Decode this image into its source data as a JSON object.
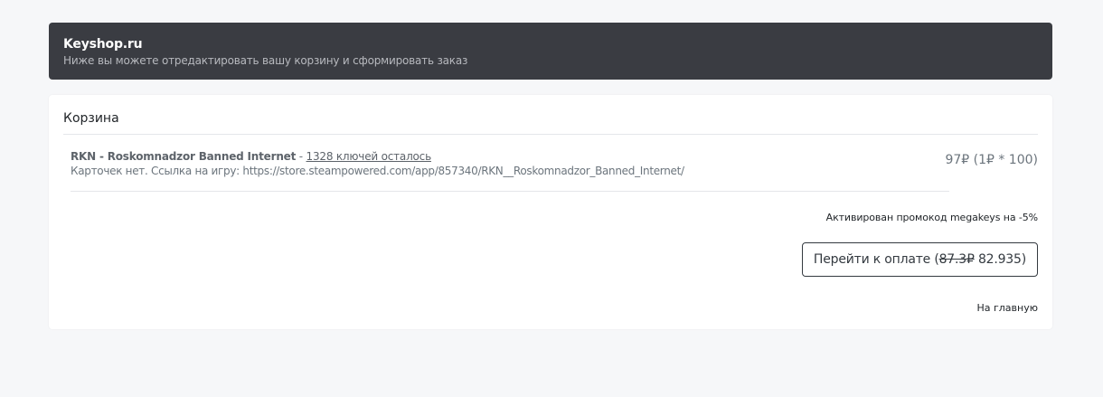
{
  "header": {
    "site_title": "Keyshop.ru",
    "subtitle": "Ниже вы можете отредактировать вашу корзину и сформировать заказ",
    "background_color": "#3a3c42"
  },
  "cart": {
    "title": "Корзина",
    "items": [
      {
        "name": "RKN - Roskomnadzor Banned Internet",
        "separator": " - ",
        "keys_left": "1328 ключей осталось",
        "description": "Карточек нет. Ссылка на игру: https://store.steampowered.com/app/857340/RKN__Roskomnadzor_Banned_Internet/",
        "price": "97₽ (1₽ * 100)"
      }
    ],
    "promo_text": "Активирован промокод megakeys на -5%",
    "pay_button": {
      "label_prefix": "Перейти к оплате (",
      "old_price": "87.3₽",
      "new_price": " 82.935)"
    },
    "home_link": "На главную"
  }
}
